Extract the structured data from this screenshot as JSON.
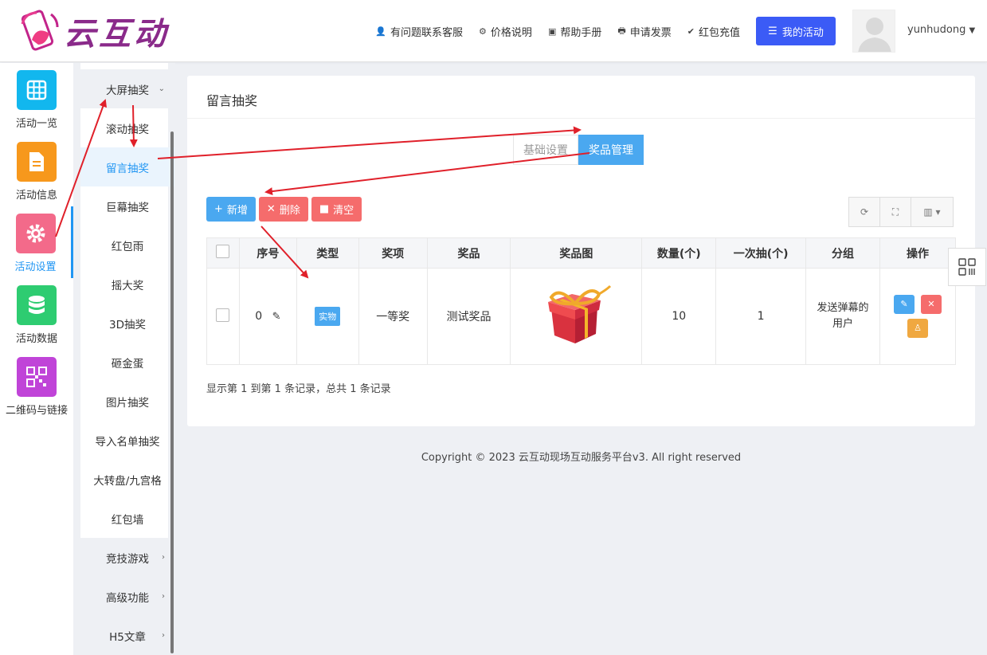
{
  "brand": {
    "name": "云互动"
  },
  "header": {
    "links": [
      {
        "icon": "user-plus-icon",
        "glyph": "👤",
        "label": "有问题联系客服"
      },
      {
        "icon": "gear-icon",
        "glyph": "⚙",
        "label": "价格说明"
      },
      {
        "icon": "book-icon",
        "glyph": "▣",
        "label": "帮助手册"
      },
      {
        "icon": "printer-icon",
        "glyph": "🖶",
        "label": "申请发票"
      },
      {
        "icon": "shield-check-icon",
        "glyph": "✔",
        "label": "红包充值"
      }
    ],
    "my_activity_label": "我的活动",
    "username": "yunhudong"
  },
  "rail": {
    "items": [
      {
        "name": "activity-list",
        "label": "活动一览",
        "color": "#12b7ee"
      },
      {
        "name": "activity-info",
        "label": "活动信息",
        "color": "#f7981c"
      },
      {
        "name": "activity-settings",
        "label": "活动设置",
        "color": "#f36a8a"
      },
      {
        "name": "activity-data",
        "label": "活动数据",
        "color": "#2ecc71"
      },
      {
        "name": "qrcode-links",
        "label": "二维码与链接",
        "color": "#c044d8"
      }
    ]
  },
  "submenu": {
    "group_label": "大屏抽奖",
    "items": [
      "滚动抽奖",
      "留言抽奖",
      "巨幕抽奖",
      "红包雨",
      "摇大奖",
      "3D抽奖",
      "砸金蛋",
      "图片抽奖",
      "导入名单抽奖",
      "大转盘/九宫格",
      "红包墙"
    ],
    "groups_below": [
      "竞技游戏",
      "高级功能",
      "H5文章"
    ]
  },
  "card": {
    "title": "留言抽奖",
    "tabs": [
      "基础设置",
      "奖品管理"
    ],
    "toolbar": {
      "add": "新增",
      "delete": "删除",
      "clear": "清空"
    },
    "table": {
      "headers": [
        "序号",
        "类型",
        "奖项",
        "奖品",
        "奖品图",
        "数量(个)",
        "一次抽(个)",
        "分组",
        "操作"
      ],
      "rows": [
        {
          "index": "0",
          "type": "实物",
          "level": "一等奖",
          "prize": "测试奖品",
          "qty": "10",
          "per_draw": "1",
          "group": "发送弹幕的用户"
        }
      ]
    },
    "records": "显示第 1 到第 1 条记录，总共 1 条记录"
  },
  "footer": {
    "copyright": "Copyright © 2023 云互动现场互动服务平台v3. All right reserved"
  },
  "colors": {
    "primary": "#4aa8f0",
    "danger": "#f56c6c",
    "warning": "#f0a840",
    "brand": "#8a2a8a",
    "my_activity": "#3b5bf6"
  }
}
